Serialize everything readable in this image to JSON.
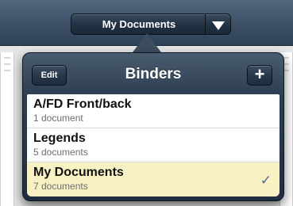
{
  "toolbar": {
    "selector_label": "My Documents",
    "dropdown_icon": "triangle-down-icon"
  },
  "popover": {
    "title": "Binders",
    "edit_label": "Edit",
    "add_label": "+",
    "binders": [
      {
        "name": "A/FD Front/back",
        "count": "1 document",
        "selected": false
      },
      {
        "name": "Legends",
        "count": "5 documents",
        "selected": false
      },
      {
        "name": "My Documents",
        "count": "7 documents",
        "selected": true
      }
    ],
    "check_glyph": "✓"
  },
  "colors": {
    "toolbar": "#3c4f65",
    "selected_row": "#f7f1c3",
    "checkmark": "#4a6f9b"
  }
}
